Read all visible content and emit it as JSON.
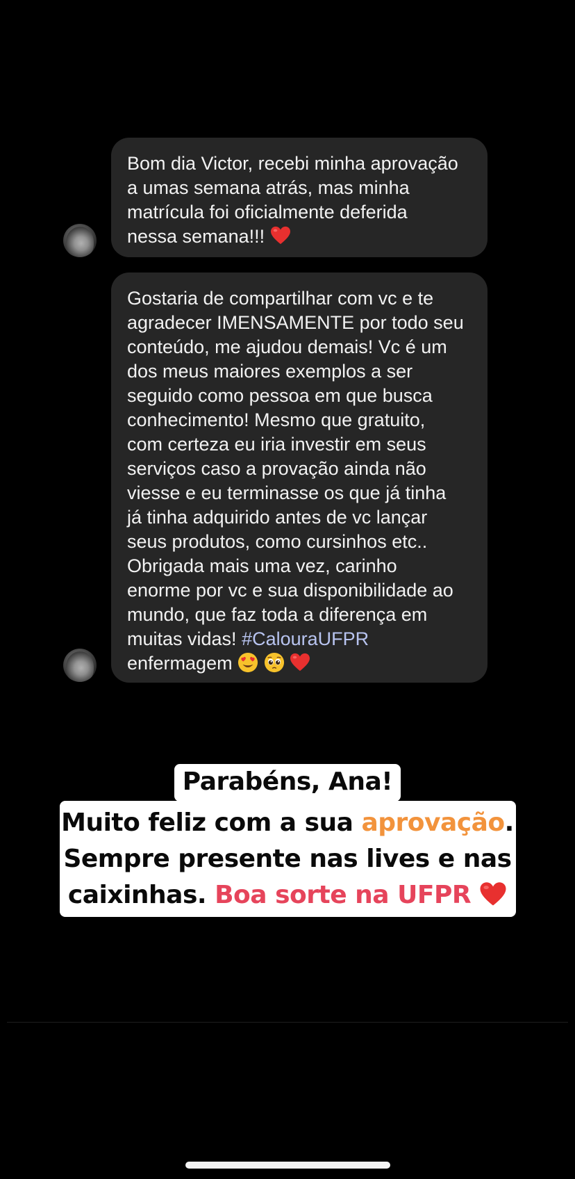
{
  "messages": [
    {
      "lines": [
        "Bom dia Victor, recebi minha aprovação",
        "a umas semana atrás, mas minha",
        "matrícula foi oficialmente deferida",
        "nessa semana!!!"
      ],
      "trailing_emoji": [
        "red-heart"
      ]
    },
    {
      "lines": [
        "Gostaria de compartilhar com vc e te",
        "agradecer IMENSAMENTE por todo seu",
        "conteúdo, me ajudou demais! Vc é um",
        "dos meus maiores exemplos a ser",
        "seguido como pessoa em que busca",
        "conhecimento! Mesmo que gratuito,",
        "com certeza eu iria investir em seus",
        "serviços caso a provação ainda não",
        "viesse e eu terminasse os que já tinha",
        "já tinha adquirido antes de vc lançar",
        "seus produtos, como cursinhos etc..",
        "Obrigada mais uma vez, carinho",
        "enorme por vc e sua disponibilidade ao",
        "mundo, que faz toda a diferença em"
      ],
      "line_14_text": "muitas vidas!",
      "hashtag": "#CalouraUFPR",
      "last_line": "enfermagem",
      "trailing_emoji": [
        "heart-eyes-face",
        "pleading-face",
        "red-heart"
      ]
    }
  ],
  "caption": {
    "line1": "Parabéns, Ana!",
    "line2_pre": "Muito feliz com a sua",
    "line2_highlight": "aprovação",
    "line2_post": ".",
    "line3": "Sempre presente nas lives e nas",
    "line4_pre": "caixinhas.",
    "line4_highlight": "Boa sorte na UFPR",
    "highlight_colors": {
      "orange": "#f2933c",
      "red": "#e6445b"
    }
  },
  "colors": {
    "background": "#000000",
    "bubble": "#262626",
    "text": "#f2f2f2",
    "hashtag": "#b8c4f0"
  }
}
